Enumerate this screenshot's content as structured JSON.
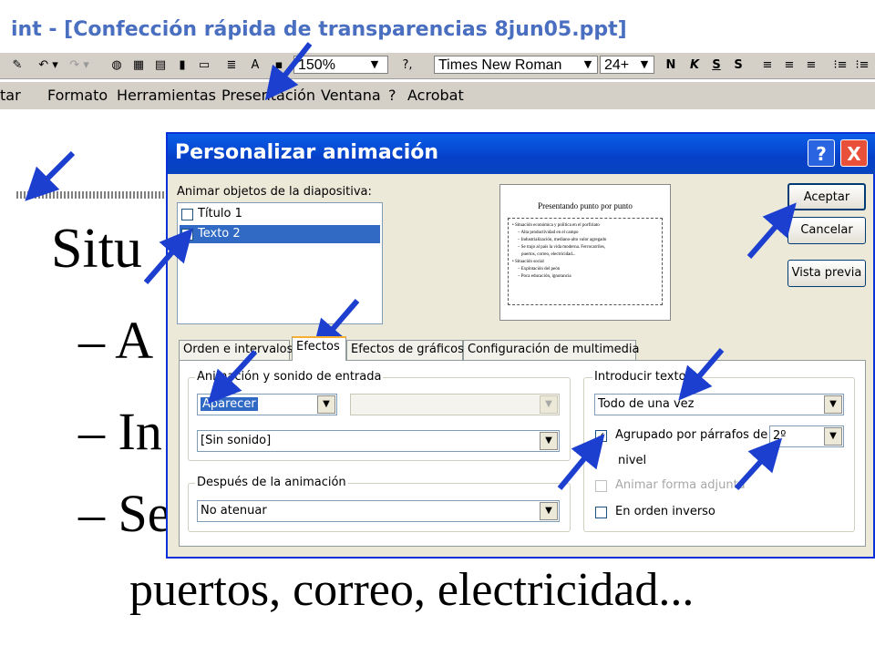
{
  "window": {
    "title": "int - [Confección rápida de transparencias 8jun05.ppt]"
  },
  "toolbar": {
    "zoom": "150%",
    "font": "Times New Roman",
    "font_size": "24+",
    "bold": "N",
    "italic": "K",
    "underline": "S",
    "shadow": "S"
  },
  "menubar": {
    "items": [
      "tar",
      "Formato",
      "Herramientas",
      "Presentación",
      "Ventana",
      "?",
      "Acrobat"
    ]
  },
  "slide": {
    "title_partial": "Situ",
    "bullet1": "– A",
    "bullet2": "– In",
    "bullet3": "– Se",
    "last_line": "puertos, correo, electricidad..."
  },
  "dialog": {
    "title": "Personalizar animación",
    "help_button": "?",
    "close_button": "X",
    "objects_label": "Animar objetos de la diapositiva:",
    "objects": [
      {
        "label": "Título 1",
        "checked": false,
        "selected": false
      },
      {
        "label": "Texto 2",
        "checked": true,
        "selected": true
      }
    ],
    "preview": {
      "title": "Presentando punto por punto",
      "lines": [
        "• Situación económica y política en el porfiriato",
        "– Alta productividad en el campo",
        "– Industrialización, mediano-alto valor agregado",
        "– Se trajo al país la vida moderna. Ferrocarriles,",
        "puertos, correo, electricidad...",
        "• Situación social",
        "– Explotación del peón",
        "– Poca educación, ignorancia"
      ]
    },
    "buttons": {
      "ok": "Aceptar",
      "cancel": "Cancelar",
      "preview": "Vista previa"
    },
    "tabs": [
      "Orden e intervalos",
      "Efectos",
      "Efectos de gráficos",
      "Configuración de multimedia"
    ],
    "active_tab": "Efectos",
    "entry_group": "Animación y sonido de entrada",
    "effect": "Aparecer",
    "sound": "[Sin sonido]",
    "after_group": "Después de la animación",
    "after": "No atenuar",
    "intro_group": "Introducir texto",
    "intro": "Todo de una vez",
    "grouped_label": "Agrupado por párrafos de",
    "grouped_checked": true,
    "grouped_level": "2º",
    "nivel": "nivel",
    "attached_shape": "Animar forma adjunta",
    "reverse_order": "En orden inverso"
  },
  "colors": {
    "dialog_title": "#0a5ee8",
    "close_button": "#e8503a",
    "selection": "#316ac5",
    "arrows": "#1c3fd0",
    "app_title": "#4a6fc0"
  }
}
